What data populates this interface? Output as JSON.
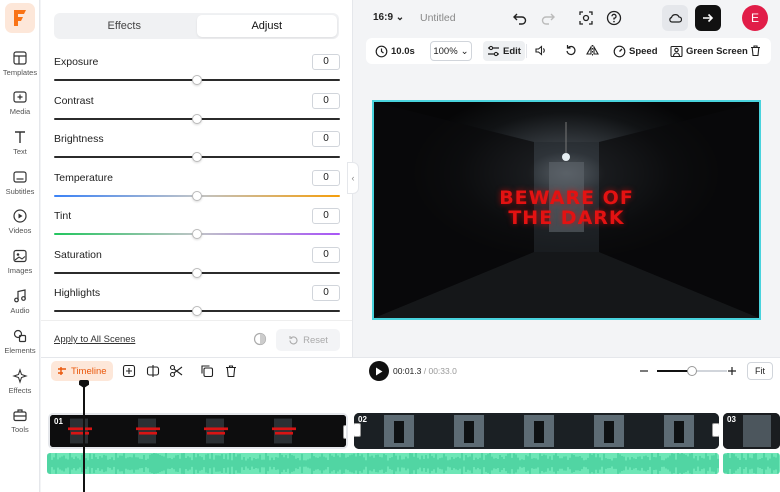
{
  "app": {
    "brand_letter": "F",
    "project_title": "Untitled",
    "aspect_ratio": "16:9",
    "avatar_initial": "E"
  },
  "colors": {
    "brand": "#f97316",
    "accent_canvas": "#49d3dd",
    "headline_red": "#e31212",
    "avatar": "#e11d48",
    "audio_wave": "#6ee7b7"
  },
  "rail": [
    {
      "label": "Templates",
      "icon": "templates-icon"
    },
    {
      "label": "Media",
      "icon": "media-icon"
    },
    {
      "label": "Text",
      "icon": "text-icon"
    },
    {
      "label": "Subtitles",
      "icon": "subtitles-icon"
    },
    {
      "label": "Videos",
      "icon": "videos-icon"
    },
    {
      "label": "Images",
      "icon": "images-icon"
    },
    {
      "label": "Audio",
      "icon": "audio-icon"
    },
    {
      "label": "Elements",
      "icon": "elements-icon"
    },
    {
      "label": "Effects",
      "icon": "effects-icon"
    },
    {
      "label": "Tools",
      "icon": "tools-icon"
    }
  ],
  "panel": {
    "tabs": [
      "Effects",
      "Adjust"
    ],
    "active_tab": "Adjust",
    "adjustments": [
      {
        "label": "Exposure",
        "value": "0",
        "level": 0.5
      },
      {
        "label": "Contrast",
        "value": "0",
        "level": 0.5
      },
      {
        "label": "Brightness",
        "value": "0",
        "level": 0.5
      },
      {
        "label": "Temperature",
        "value": "0",
        "level": 0.5
      },
      {
        "label": "Tint",
        "value": "0",
        "level": 0.5
      },
      {
        "label": "Saturation",
        "value": "0",
        "level": 0.5
      },
      {
        "label": "Highlights",
        "value": "0",
        "level": 0.5
      }
    ],
    "apply_all": "Apply to All Scenes",
    "reset": "Reset"
  },
  "toolbar": {
    "duration": "10.0s",
    "zoom": "100%",
    "edit": "Edit",
    "speed": "Speed",
    "green_screen": "Green Screen"
  },
  "canvas": {
    "headline_line1": "BEWARE OF",
    "headline_line2": "THE DARK"
  },
  "timeline": {
    "label": "Timeline",
    "current_time": "00:01.3",
    "total_time": "/ 00:33.0",
    "fit": "Fit",
    "zoom_level": 0.5,
    "clips": [
      {
        "num": "01"
      },
      {
        "num": "02"
      },
      {
        "num": "03"
      }
    ]
  }
}
